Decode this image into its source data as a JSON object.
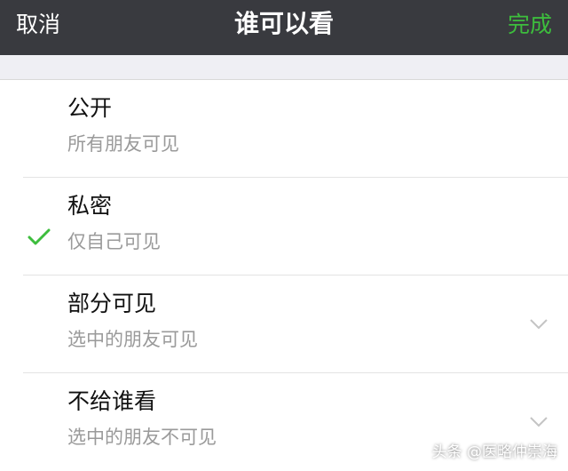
{
  "navbar": {
    "cancel_label": "取消",
    "title": "谁可以看",
    "done_label": "完成",
    "done_color": "#3dbd3d",
    "background": "#393a3f"
  },
  "options": [
    {
      "title": "公开",
      "subtitle": "所有朋友可见",
      "selected": false,
      "expandable": false
    },
    {
      "title": "私密",
      "subtitle": "仅自己可见",
      "selected": false,
      "expandable": false
    },
    {
      "title": "部分可见",
      "subtitle": "选中的朋友可见",
      "selected": true,
      "expandable": true
    },
    {
      "title": "不给谁看",
      "subtitle": "选中的朋友不可见",
      "selected": false,
      "expandable": true
    }
  ],
  "icons": {
    "selected": "checkmark-icon",
    "expand": "chevron-down-icon"
  },
  "watermark": "头条 @医略仲崇海"
}
